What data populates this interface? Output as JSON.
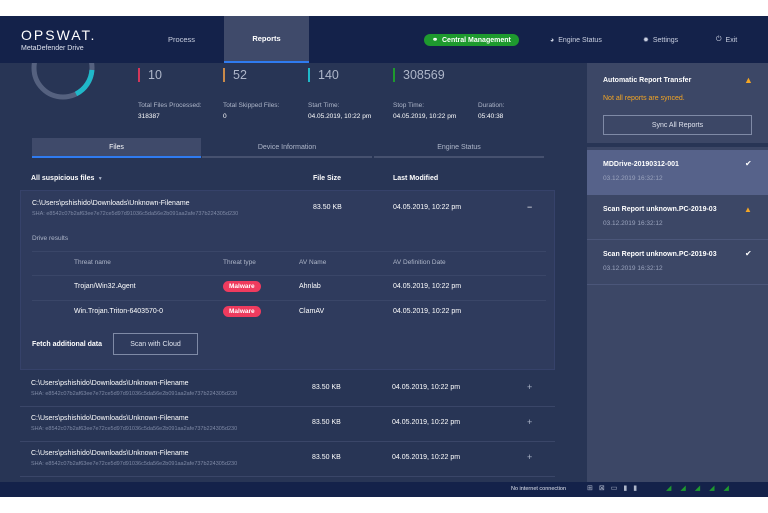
{
  "header": {
    "brand": "OPSWAT.",
    "product": "MetaDefender Drive",
    "nav": [
      "Process",
      "Reports"
    ],
    "active_nav": "Reports",
    "central_management": "Central Management",
    "engine_status": "Engine Status",
    "settings": "Settings",
    "exit": "Exit"
  },
  "stats": {
    "counts": [
      {
        "value": "10",
        "color": "#d2375a"
      },
      {
        "value": "52",
        "color": "#c98a4a"
      },
      {
        "value": "140",
        "color": "#1fb8c9"
      },
      {
        "value": "308569",
        "color": "#1e9a2e"
      }
    ],
    "details": [
      {
        "label": "Total Files Processed:",
        "value": "318387"
      },
      {
        "label": "Total Skipped Files:",
        "value": "0"
      },
      {
        "label": "Start Time:",
        "value": "04.05.2019, 10:22 pm"
      },
      {
        "label": "Stop Time:",
        "value": "04.05.2019, 10:22 pm"
      },
      {
        "label": "Duration:",
        "value": "05:40:38"
      }
    ]
  },
  "tabs": [
    "Files",
    "Device Information",
    "Engine Status"
  ],
  "table": {
    "filter": "All suspicious files",
    "col_size": "File Size",
    "col_modified": "Last Modified",
    "rows": [
      {
        "path": "C:\\Users\\pshishido\\Downloads\\Unknown-Filename",
        "sha": "SHA: e8542c07b2af63ee7e72ce5d97d91036c5da56e2b091aa2afe737b224305d230",
        "size": "83.50 KB",
        "modified": "04.05.2019, 10:22 pm",
        "toggle": "−"
      },
      {
        "path": "C:\\Users\\pshishido\\Downloads\\Unknown-Filename",
        "sha": "SHA: e8542c07b2af63ee7e72ce5d97d91036c5da56e2b091aa2afe737b224305d230",
        "size": "83.50 KB",
        "modified": "04.05.2019, 10:22 pm",
        "toggle": "+"
      },
      {
        "path": "C:\\Users\\pshishido\\Downloads\\Unknown-Filename",
        "sha": "SHA: e8542c07b2af63ee7e72ce5d97d91036c5da56e2b091aa2afe737b224305d230",
        "size": "83.50 KB",
        "modified": "04.05.2019, 10:22 pm",
        "toggle": "+"
      },
      {
        "path": "C:\\Users\\pshishido\\Downloads\\Unknown-Filename",
        "sha": "SHA: e8542c07b2af63ee7e72ce5d97d91036c5da56e2b091aa2afe737b224305d230",
        "size": "83.50 KB",
        "modified": "04.05.2019, 10:22 pm",
        "toggle": "+"
      }
    ],
    "drive_results": {
      "title": "Drive results",
      "headers": [
        "Threat name",
        "Threat type",
        "AV Name",
        "AV Definition Date"
      ],
      "rows": [
        {
          "name": "Trojan/Win32.Agent",
          "type": "Malware",
          "av": "Ahnlab",
          "date": "04.05.2019, 10:22 pm"
        },
        {
          "name": "Win.Trojan.Triton-6403570-0",
          "type": "Malware",
          "av": "ClamAV",
          "date": "04.05.2019, 10:22 pm"
        }
      ]
    },
    "fetch_label": "Fetch additional data",
    "scan_cloud": "Scan with Cloud"
  },
  "right": {
    "title": "Automatic Report Transfer",
    "warning": "Not all reports are synced.",
    "sync_button": "Sync All Reports",
    "reports": [
      {
        "name": "MDDrive-20190312-001",
        "date": "03.12.2019 16:32:12",
        "status": "ok"
      },
      {
        "name": "Scan Report unknown.PC-2019-03",
        "date": "03.12.2019 16:32:12",
        "status": "warning"
      },
      {
        "name": "Scan Report unknown.PC-2019-03",
        "date": "03.12.2019 16:32:12",
        "status": "ok"
      }
    ]
  },
  "footer": {
    "status": "No internet connection"
  },
  "colors": {
    "header": "#14224a",
    "accent": "#2f7bf0",
    "malware": "#ef3b5e",
    "warning": "#f5a623",
    "success": "#1e9a2e"
  }
}
